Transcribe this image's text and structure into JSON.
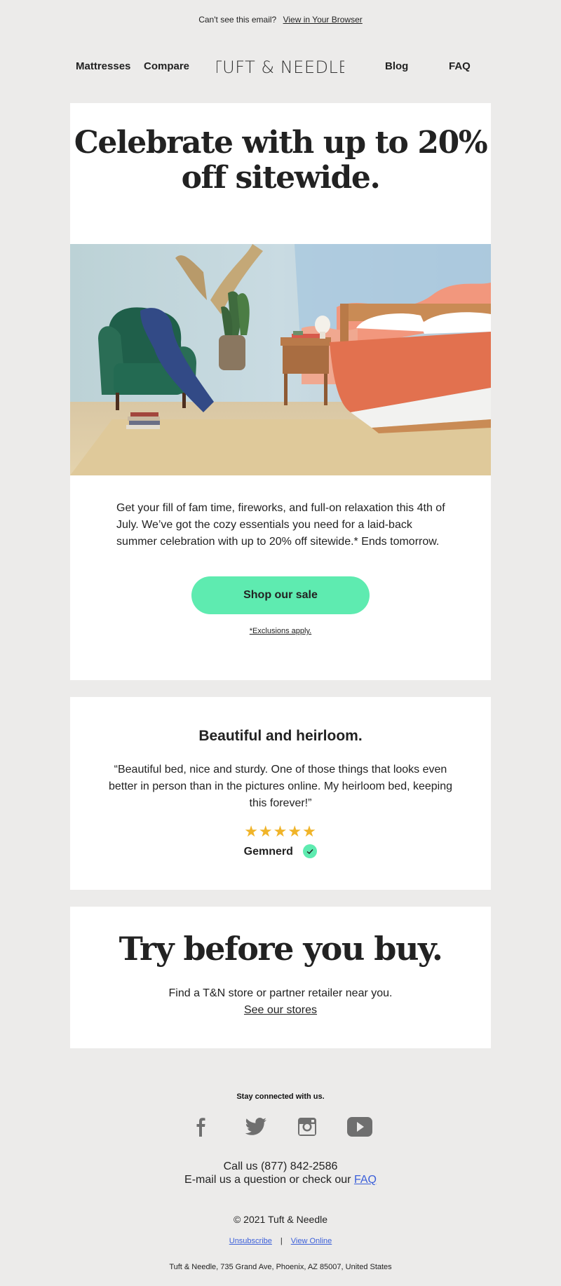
{
  "preheader": {
    "text": "Can't see this email?",
    "link": "View in Your Browser"
  },
  "nav": {
    "items": [
      "Mattresses",
      "Compare",
      "Blog",
      "FAQ"
    ],
    "logo": "TUFT & NEEDLE"
  },
  "hero_section": {
    "headline": "Celebrate with up to 20% off sitewide.",
    "body": "Get your fill of fam time, fireworks, and full-on relaxation this 4th of July. We’ve got the cozy essentials you need for a laid-back summer celebration with up to 20% off sitewide.* Ends tomorrow.",
    "cta": "Shop our sale",
    "disclaimer": "*Exclusions apply."
  },
  "review": {
    "title": "Beautiful and heirloom.",
    "quote": "“Beautiful bed, nice and sturdy. One of those things that looks even better in person than in the pictures online. My heirloom bed, keeping this forever!”",
    "stars": "★★★★★",
    "rating": 5,
    "reviewer": "Gemnerd"
  },
  "stores": {
    "headline": "Try before you buy.",
    "text": "Find a T&N store or partner retailer near you.",
    "link": "See our stores"
  },
  "footer": {
    "stay": "Stay connected with us.",
    "social": [
      "facebook-icon",
      "twitter-icon",
      "instagram-icon",
      "youtube-icon"
    ],
    "call": "Call us (877) 842-2586",
    "email_prefix": "E-mail us a question or check our",
    "email_link": "FAQ",
    "copyright": "© 2021 Tuft & Needle",
    "unsubscribe": "Unsubscribe",
    "separator": "|",
    "view_online": "View Online",
    "address": "Tuft & Needle, 735 Grand Ave, Phoenix, AZ 85007, United States"
  },
  "colors": {
    "accent": "#5eebb0",
    "star": "#f0b429",
    "link": "#3b5fd9",
    "background": "#ecebea"
  }
}
